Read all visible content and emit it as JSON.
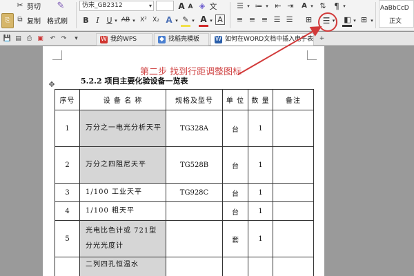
{
  "ribbon": {
    "cut_label": "剪切",
    "copy_label": "复制",
    "format_painter_label": "格式刷",
    "font_name": "仿宋_GB2312",
    "font_size": "",
    "bold": "B",
    "italic": "I",
    "underline": "U",
    "abc_label": "AB",
    "superscript": "X²",
    "subscript": "X₂",
    "font_grow": "A",
    "font_shrink": "A",
    "font_color_label": "A",
    "wen_label": "文",
    "style_sample": "AaBbCcD",
    "style_name": "正文"
  },
  "tabs": {
    "items": [
      {
        "label": "我的WPS",
        "icon": "wps-logo-icon",
        "icon_text": "W",
        "color": "#d0352f"
      },
      {
        "label": "找稻壳模板",
        "icon": "docer-icon",
        "icon_text": "◆",
        "color": "#4a7fd0"
      },
      {
        "label": "如何在WORD文档中插入电子表格.docx",
        "icon": "word-doc-icon",
        "icon_text": "W",
        "color": "#2b5faa"
      }
    ]
  },
  "annotation": {
    "text": "第二步 找到行距调整图标",
    "color": "#d04444"
  },
  "document": {
    "heading": "5.2.2 项目主要化验设备一览表",
    "table": {
      "headers": [
        "序号",
        "设 备 名 称",
        "规格及型号",
        "单 位",
        "数 量",
        "备注"
      ],
      "rows": [
        {
          "no": "1",
          "name": "万分之一电光分析天平",
          "spec": "TG328A",
          "unit": "台",
          "qty": "1",
          "note": ""
        },
        {
          "no": "2",
          "name": "万分之四阻尼天平",
          "spec": "TG528B",
          "unit": "台",
          "qty": "1",
          "note": ""
        },
        {
          "no": "3",
          "name": "1/100 工业天平",
          "spec": "TG928C",
          "unit": "台",
          "qty": "1",
          "note": ""
        },
        {
          "no": "4",
          "name": "1/100  粗天平",
          "spec": "",
          "unit": "台",
          "qty": "1",
          "note": ""
        },
        {
          "no": "5",
          "name": "光电比色计或 721型分光光度计",
          "spec": "",
          "unit": "套",
          "qty": "1",
          "note": ""
        },
        {
          "no": "",
          "name": "二列四孔恒温水",
          "spec": "",
          "unit": "",
          "qty": "",
          "note": ""
        }
      ]
    }
  },
  "colors": {
    "highlight": "#d23a3a",
    "shaded_cell": "#d6d6d6"
  }
}
